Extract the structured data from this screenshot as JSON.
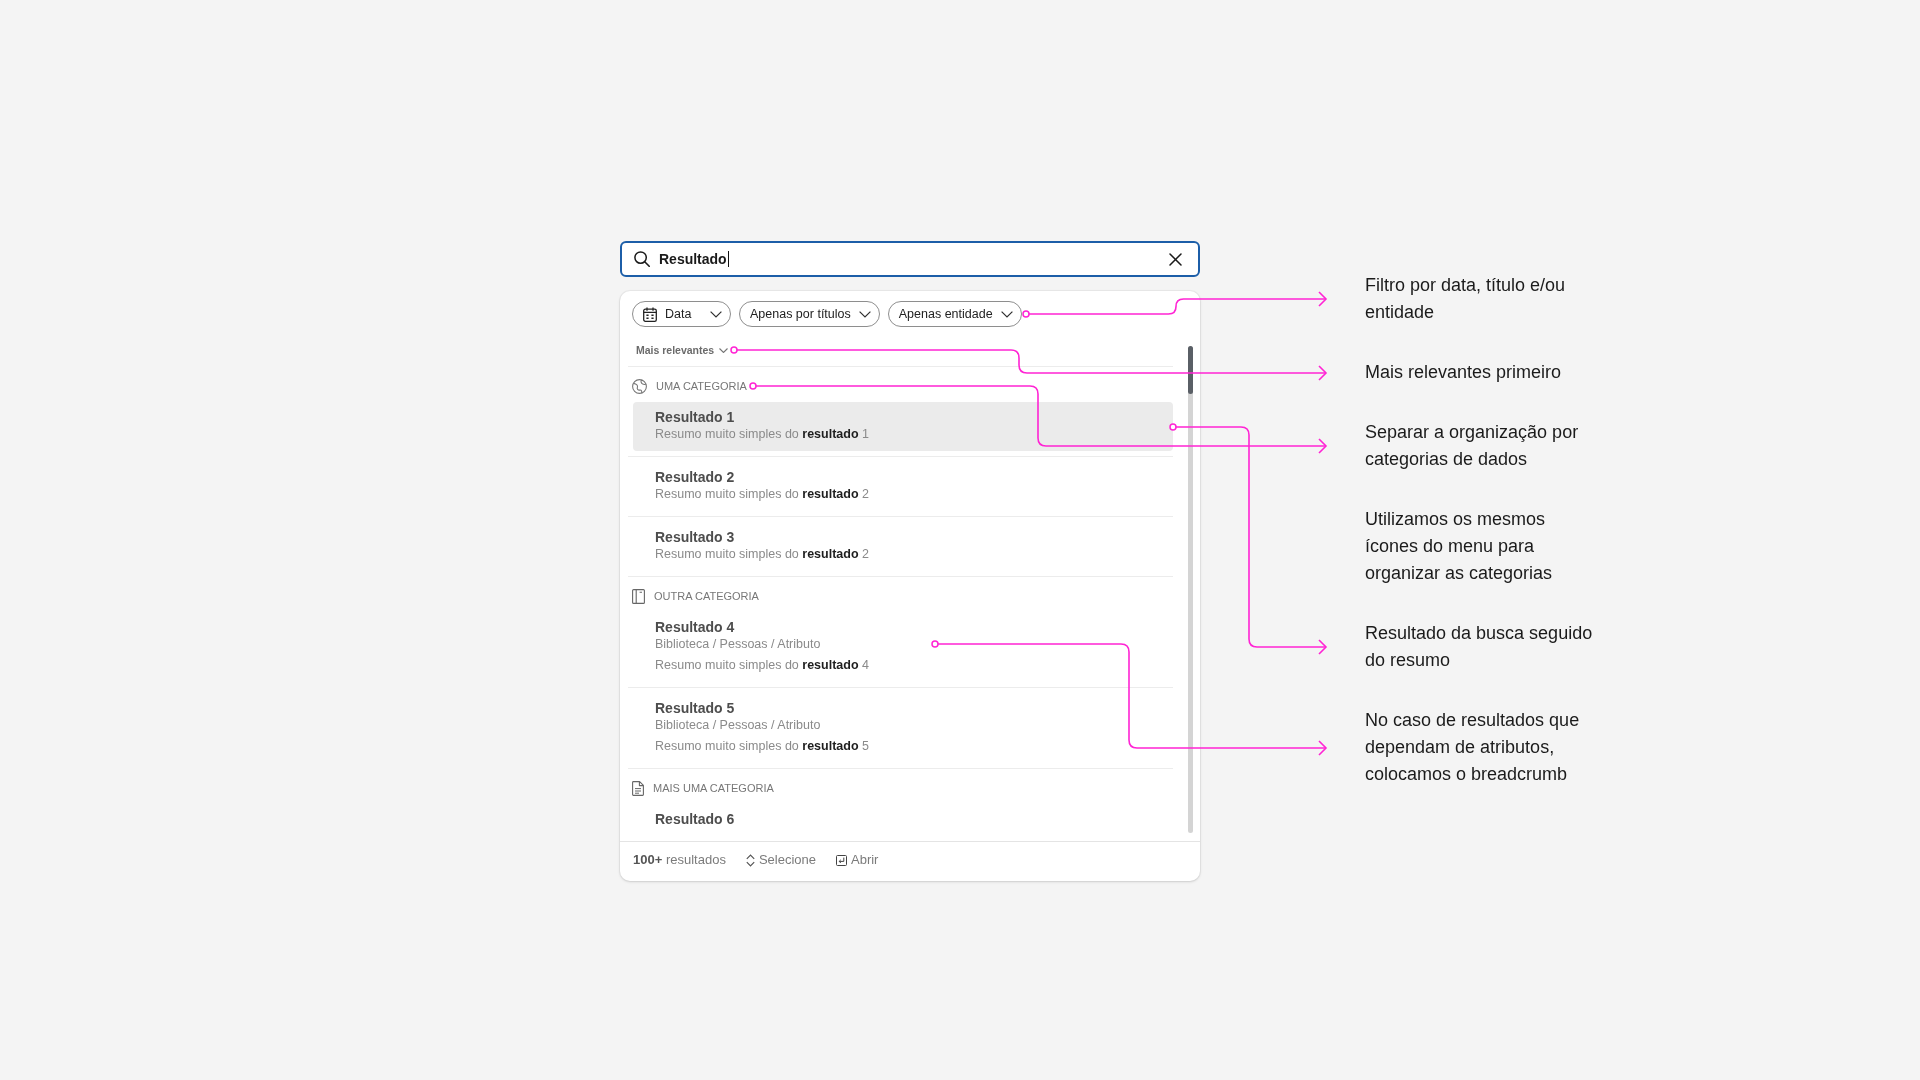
{
  "search": {
    "value": "Resultado"
  },
  "filters": [
    {
      "kind": "date",
      "label": "Data"
    },
    {
      "kind": "select",
      "label": "Apenas por títulos"
    },
    {
      "kind": "select",
      "label": "Apenas entidade"
    }
  ],
  "sort": {
    "label": "Mais relevantes"
  },
  "categories": [
    {
      "label": "UMA CATEGORIA",
      "results": [
        {
          "title": "Resultado 1",
          "summary": "Resumo muito simples do **resultado** 1",
          "selected": true
        },
        {
          "title": "Resultado 2",
          "summary": "Resumo muito simples do **resultado** 2",
          "selected": false
        },
        {
          "title": "Resultado 3",
          "summary": "Resumo muito simples do **resultado** 2",
          "selected": false
        }
      ]
    },
    {
      "label": "OUTRA CATEGORIA",
      "results": [
        {
          "title": "Resultado 4",
          "breadcrumb": "Biblioteca / Pessoas / Atributo",
          "summary": "Resumo muito simples do **resultado** 4",
          "selected": false
        },
        {
          "title": "Resultado 5",
          "breadcrumb": "Biblioteca / Pessoas / Atributo",
          "summary": "Resumo muito simples do **resultado** 5",
          "selected": false
        }
      ]
    },
    {
      "label": "MAIS UMA CATEGORIA",
      "results": [
        {
          "title": "Resultado 6",
          "selected": false
        }
      ]
    }
  ],
  "footer": {
    "count": "**100+** resultados",
    "hints": [
      {
        "kind": "select",
        "label": "Selecione"
      },
      {
        "kind": "open",
        "label": "Abrir"
      }
    ]
  },
  "annotations": [
    {
      "text": "Filtro por data, título e/ou entidade",
      "arrow": true
    },
    {
      "text": "Mais relevantes primeiro",
      "arrow": true
    },
    {
      "text": "Separar a organização por categorias de dados",
      "arrow": true
    },
    {
      "text": "Utilizamos os mesmos ícones do menu para organizar as categorias",
      "arrow": false
    },
    {
      "text": "Resultado da busca seguido do resumo",
      "arrow": true
    },
    {
      "text": "No caso de resultados que dependam de atributos, colocamos o breadcrumb",
      "arrow": true
    }
  ]
}
